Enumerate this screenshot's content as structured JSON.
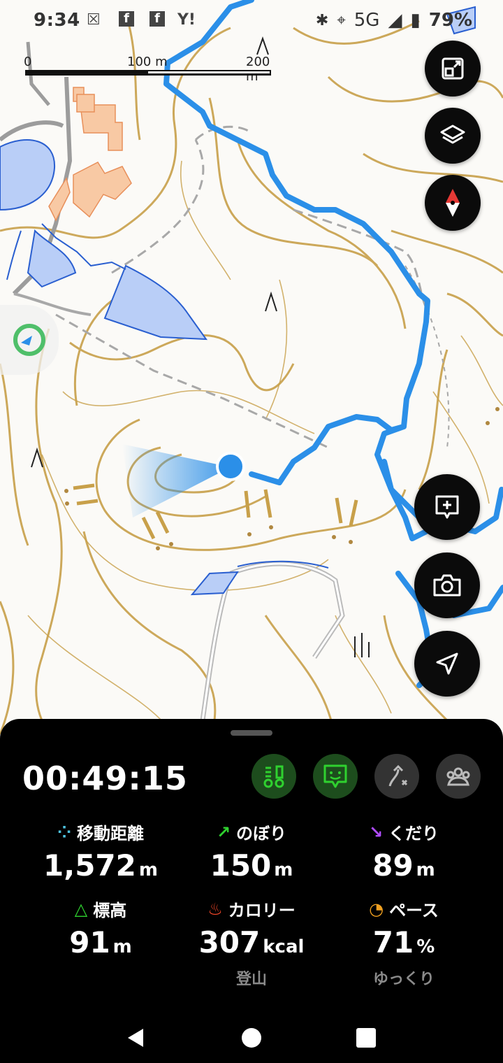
{
  "status_bar": {
    "time": "9:34",
    "network": "5G",
    "battery": "79%"
  },
  "map": {
    "scale": {
      "label_0": "0",
      "label_mid": "100 m",
      "label_end": "200 m"
    }
  },
  "buttons": {
    "fit_view": "fit-screen-icon",
    "layers": "layers-icon",
    "compass": "compass-icon",
    "add_memo": "add-memo-icon",
    "camera": "camera-icon",
    "locate": "location-arrow-icon"
  },
  "panel": {
    "timer": "00:49:15",
    "modes": [
      {
        "name": "course-mode",
        "active": true,
        "color": "#2fd12f"
      },
      {
        "name": "memo-mode",
        "active": true,
        "color": "#2fd12f"
      },
      {
        "name": "route-off-mode",
        "active": false,
        "color": "#bbbbbb"
      },
      {
        "name": "group-mode",
        "active": false,
        "color": "#bbbbbb"
      }
    ],
    "stats": [
      {
        "label": "移動距離",
        "value": "1,572",
        "unit": "m",
        "icon": "distance-icon",
        "color": "#4ec3e0"
      },
      {
        "label": "のぼり",
        "value": "150",
        "unit": "m",
        "icon": "ascent-icon",
        "color": "#2fd12f"
      },
      {
        "label": "くだり",
        "value": "89",
        "unit": "m",
        "icon": "descent-icon",
        "color": "#b04cff"
      },
      {
        "label": "標高",
        "value": "91",
        "unit": "m",
        "icon": "elevation-icon",
        "color": "#2fd12f"
      },
      {
        "label": "カロリー",
        "value": "307",
        "unit": "kcal",
        "sub": "登山",
        "icon": "calorie-icon",
        "color": "#ff4a2a"
      },
      {
        "label": "ペース",
        "value": "71",
        "unit": "%",
        "sub": "ゆっくり",
        "icon": "pace-icon",
        "color": "#f0a020"
      }
    ]
  },
  "colors": {
    "track": "#2b8fe8",
    "contour": "#c8a04a",
    "water": "#b9cef7",
    "building": "#f8c9a4"
  }
}
